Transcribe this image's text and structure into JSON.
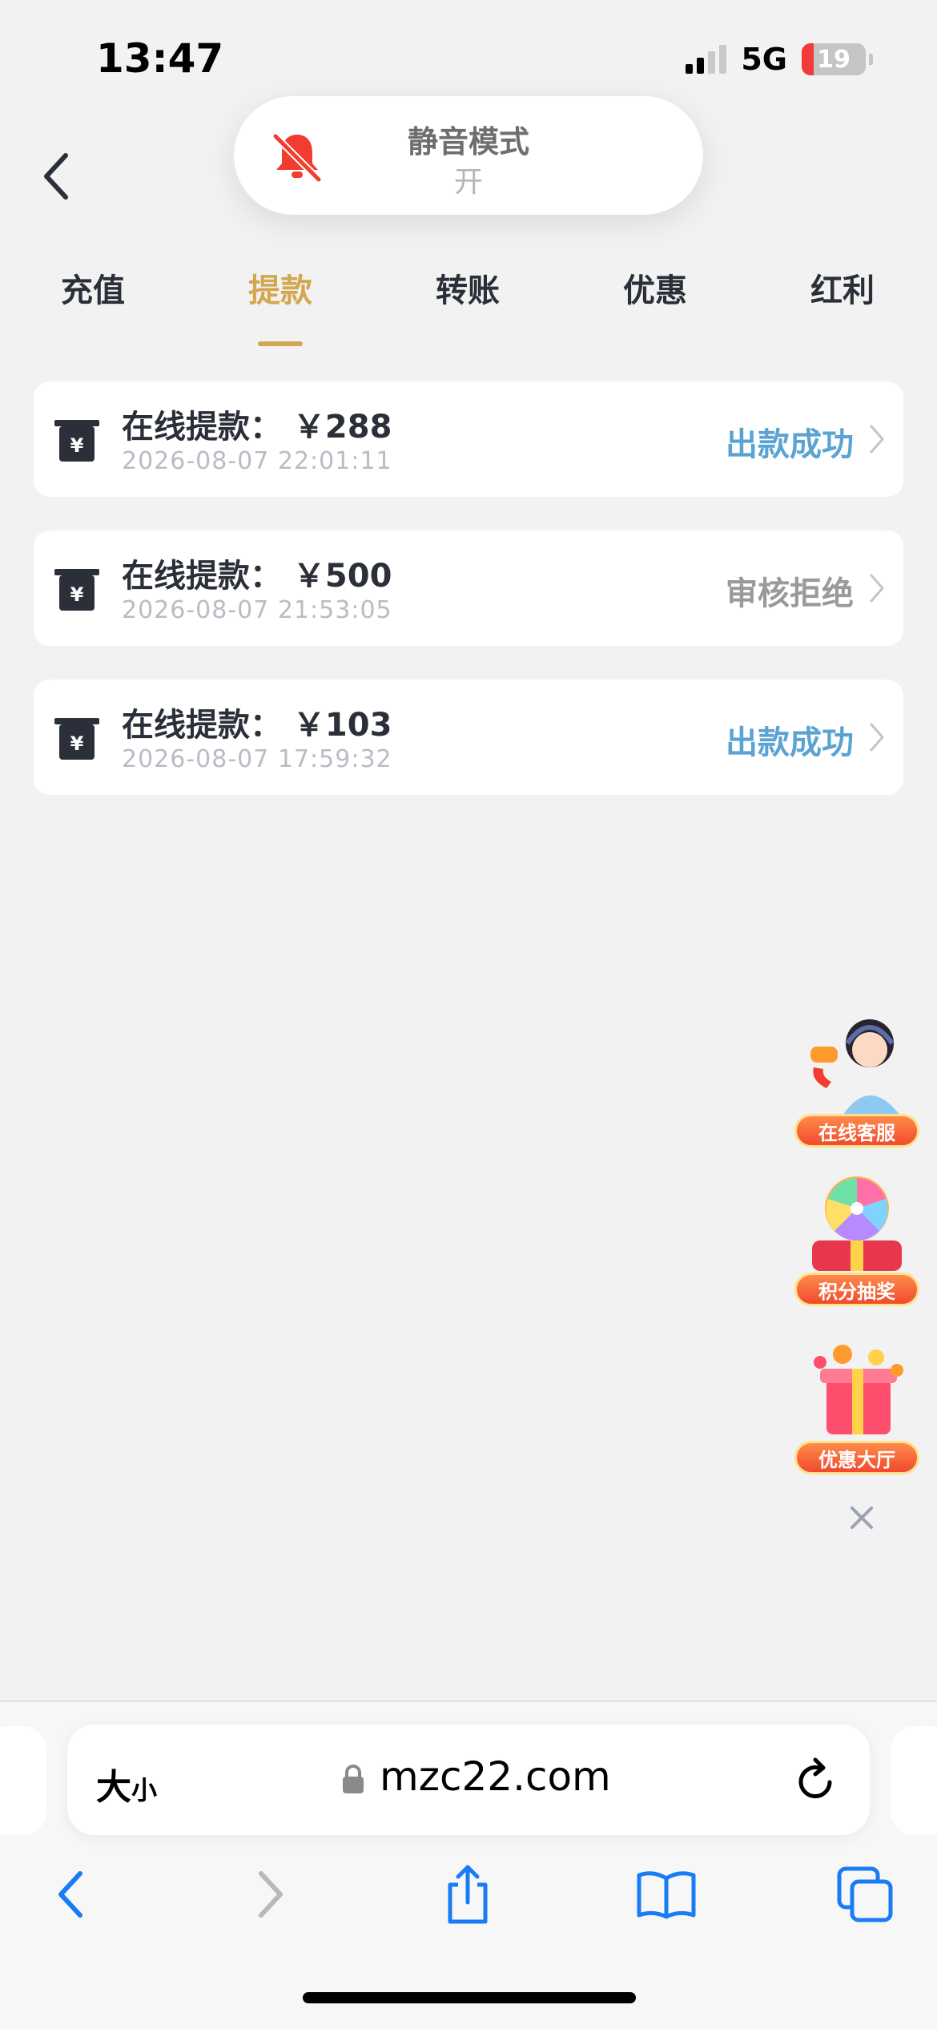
{
  "status_bar": {
    "time": "13:47",
    "network": "5G",
    "battery": "19",
    "battery_level": 0.19
  },
  "silent_mode": {
    "title": "静音模式",
    "state": "开"
  },
  "tabs": [
    {
      "label": "充值",
      "active": false
    },
    {
      "label": "提款",
      "active": true
    },
    {
      "label": "转账",
      "active": false
    },
    {
      "label": "优惠",
      "active": false
    },
    {
      "label": "红利",
      "active": false
    }
  ],
  "records": [
    {
      "title": "在线提款：",
      "amount": "￥288",
      "time": "2026-08-07 22:01:11",
      "status": "出款成功",
      "status_type": "ok"
    },
    {
      "title": "在线提款：",
      "amount": "￥500",
      "time": "2026-08-07 21:53:05",
      "status": "审核拒绝",
      "status_type": "reject"
    },
    {
      "title": "在线提款：",
      "amount": "￥103",
      "time": "2026-08-07 17:59:32",
      "status": "出款成功",
      "status_type": "ok"
    }
  ],
  "floating": {
    "items": [
      {
        "label": "在线客服"
      },
      {
        "label": "积分抽奖"
      },
      {
        "label": "优惠大厅"
      }
    ]
  },
  "browser": {
    "text_size": "大",
    "text_size_small": "小",
    "url": "mzc22.com"
  },
  "colors": {
    "accent_gold": "#d3a74f",
    "success_blue": "#5aa3d3",
    "reject_gray": "#9a9a9a",
    "ios_blue": "#1a7cf5"
  }
}
